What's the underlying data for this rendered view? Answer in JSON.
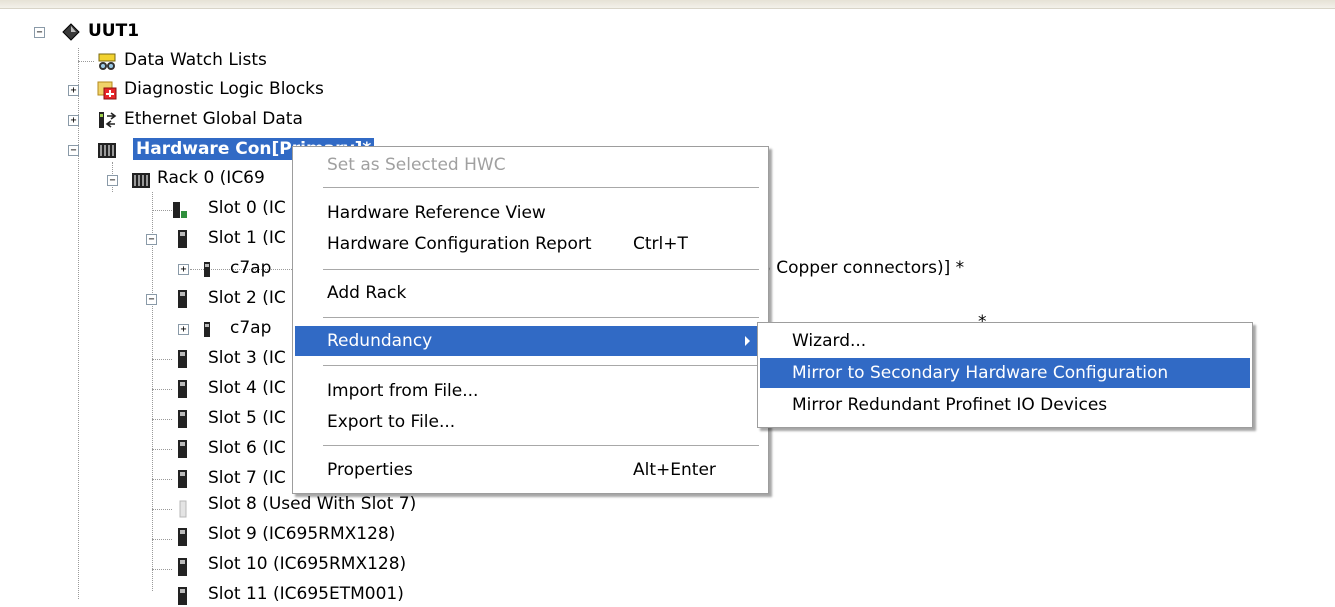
{
  "tree": {
    "root": {
      "label": "UUT1"
    },
    "items": [
      {
        "label": "Data Watch Lists"
      },
      {
        "label": "Diagnostic Logic Blocks"
      },
      {
        "label": "Ethernet Global Data"
      },
      {
        "label": "Hardware Con[Primary]*"
      },
      {
        "label": "Rack 0 (IC69"
      },
      {
        "label": "Slot 0 (IC"
      },
      {
        "label": "Slot 1 (IC"
      },
      {
        "label": "c7ap"
      },
      {
        "label": "Slot 2 (IC"
      },
      {
        "label": "c7ap"
      },
      {
        "label": "Slot 3 (IC"
      },
      {
        "label": "Slot 4 (IC"
      },
      {
        "label": "Slot 5 (IC"
      },
      {
        "label": "Slot 6 (IC"
      },
      {
        "label": "Slot 7 (IC"
      },
      {
        "label": "Slot 8 (Used With Slot 7)"
      },
      {
        "label": "Slot 9 (IC695RMX128)"
      },
      {
        "label": "Slot 10 (IC695RMX128)"
      },
      {
        "label": "Slot 11 (IC695ETM001)"
      }
    ],
    "trailing_fragment_1": "5 Copper connectors)] *",
    "trailing_fragment_2": "*"
  },
  "context_menu": {
    "items": [
      {
        "label": "Set as Selected HWC",
        "shortcut": "",
        "disabled": true
      },
      {
        "label": "Hardware Reference View",
        "shortcut": ""
      },
      {
        "label": "Hardware Configuration Report",
        "shortcut": "Ctrl+T"
      },
      {
        "label": "Add Rack",
        "shortcut": ""
      },
      {
        "label": "Redundancy",
        "shortcut": "",
        "submenu": true,
        "highlighted": true
      },
      {
        "label": "Import from File...",
        "shortcut": ""
      },
      {
        "label": "Export to File...",
        "shortcut": ""
      },
      {
        "label": "Properties",
        "shortcut": "Alt+Enter"
      }
    ]
  },
  "submenu": {
    "items": [
      {
        "label": "Wizard..."
      },
      {
        "label": "Mirror to Secondary Hardware Configuration",
        "highlighted": true
      },
      {
        "label": "Mirror Redundant Profinet IO Devices"
      }
    ]
  },
  "colors": {
    "selection": "#316ac5",
    "menu_border": "#9d9d9d",
    "disabled_text": "#a0a0a0"
  }
}
